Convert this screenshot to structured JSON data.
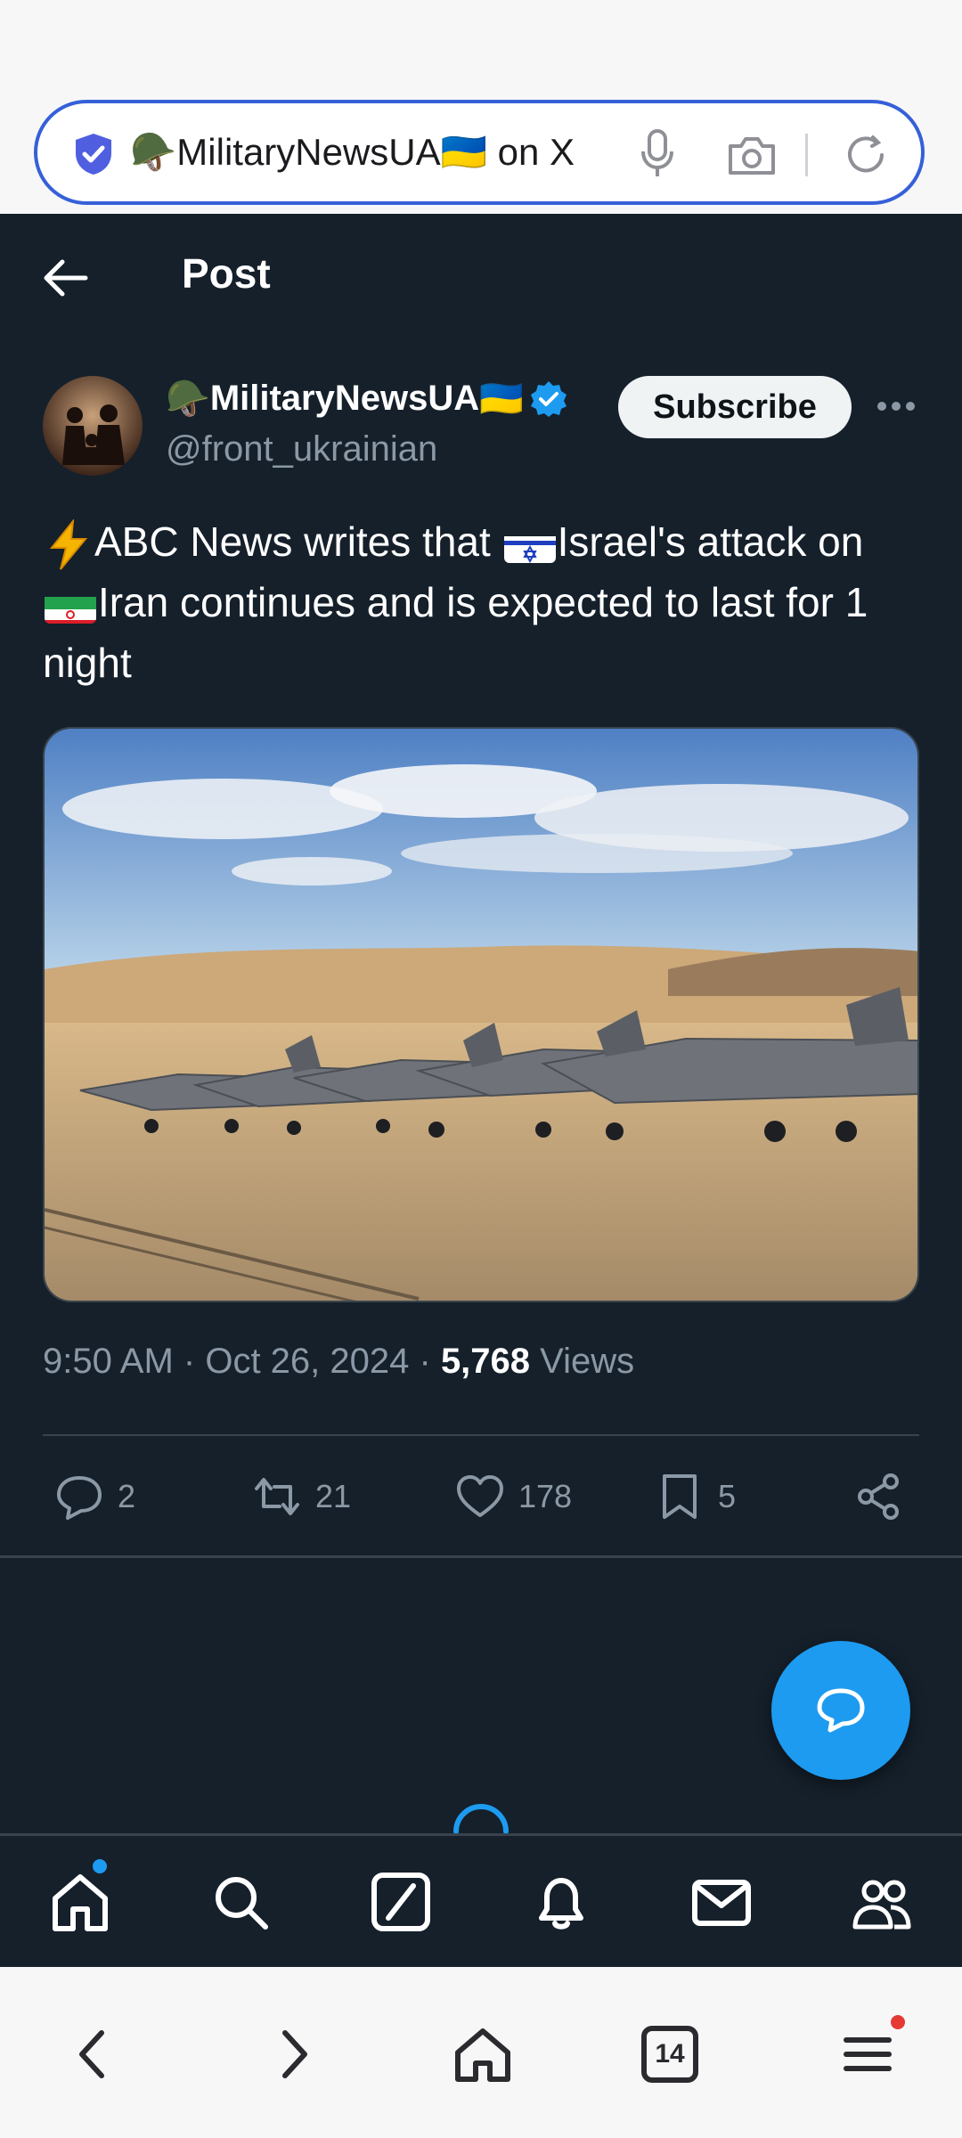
{
  "browser": {
    "url_title": "🪖MilitaryNewsUA🇺🇦 on X",
    "tab_count": "14"
  },
  "header": {
    "title": "Post"
  },
  "post": {
    "author_emoji": "🪖",
    "author_name": "MilitaryNewsUA",
    "author_flag": "🇺🇦",
    "handle": "@front_ukrainian",
    "subscribe_label": "Subscribe",
    "text_parts": {
      "p1": "ABC News writes that ",
      "p2": "Israel's attack on ",
      "p3": "Iran continues and is expected to last for 1 night"
    },
    "image_alt": "Row of F-35 fighter jets on a desert airfield",
    "time": "9:50 AM",
    "date": "Oct 26, 2024",
    "views_count": "5,768",
    "views_label": "Views",
    "replies": "2",
    "reposts": "21",
    "likes": "178",
    "bookmarks": "5"
  },
  "icons": {
    "verified": "verified-badge-icon",
    "reply": "reply-icon",
    "repost": "repost-icon",
    "like": "heart-icon",
    "bookmark": "bookmark-icon",
    "share": "share-icon"
  },
  "colors": {
    "background": "#15202b",
    "accent": "#1d9bf0",
    "muted": "#8b98a5",
    "url_border": "#3660d8"
  }
}
